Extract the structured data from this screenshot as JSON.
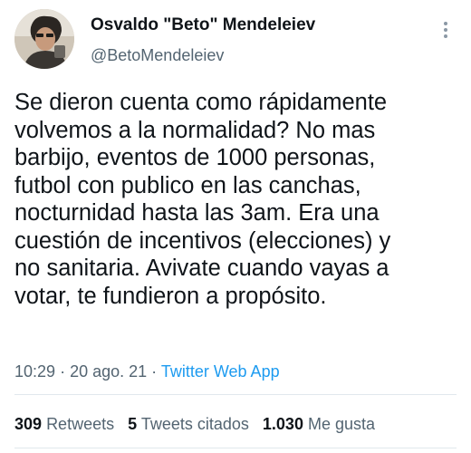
{
  "author": {
    "name": "Osvaldo \"Beto\" Mendeleiev",
    "handle": "@BetoMendeleiev"
  },
  "menu_icon": "more-vertical-icon",
  "tweet": {
    "lines": [
      "Se dieron cuenta como rápidamente",
      "volvemos a la normalidad? No mas",
      "barbijo, eventos de 1000 personas,",
      "futbol con publico en las canchas,",
      "nocturnidad hasta las 3am. Era una",
      "cuestión de incentivos (elecciones) y",
      "no sanitaria. Avivate cuando vayas a",
      "votar, te fundieron a propósito."
    ]
  },
  "meta": {
    "time": "10:29",
    "date": "20 ago. 21",
    "separator": "·",
    "source": "Twitter Web App"
  },
  "stats": {
    "retweets": {
      "count": "309",
      "label": "Retweets"
    },
    "quotes": {
      "count": "5",
      "label": "Tweets citados"
    },
    "likes": {
      "count": "1.030",
      "label": "Me gusta"
    }
  },
  "colors": {
    "link": "#1d9bf0",
    "secondary_text": "#536471",
    "primary_text": "#0f1419",
    "divider": "#e1e8ed"
  }
}
